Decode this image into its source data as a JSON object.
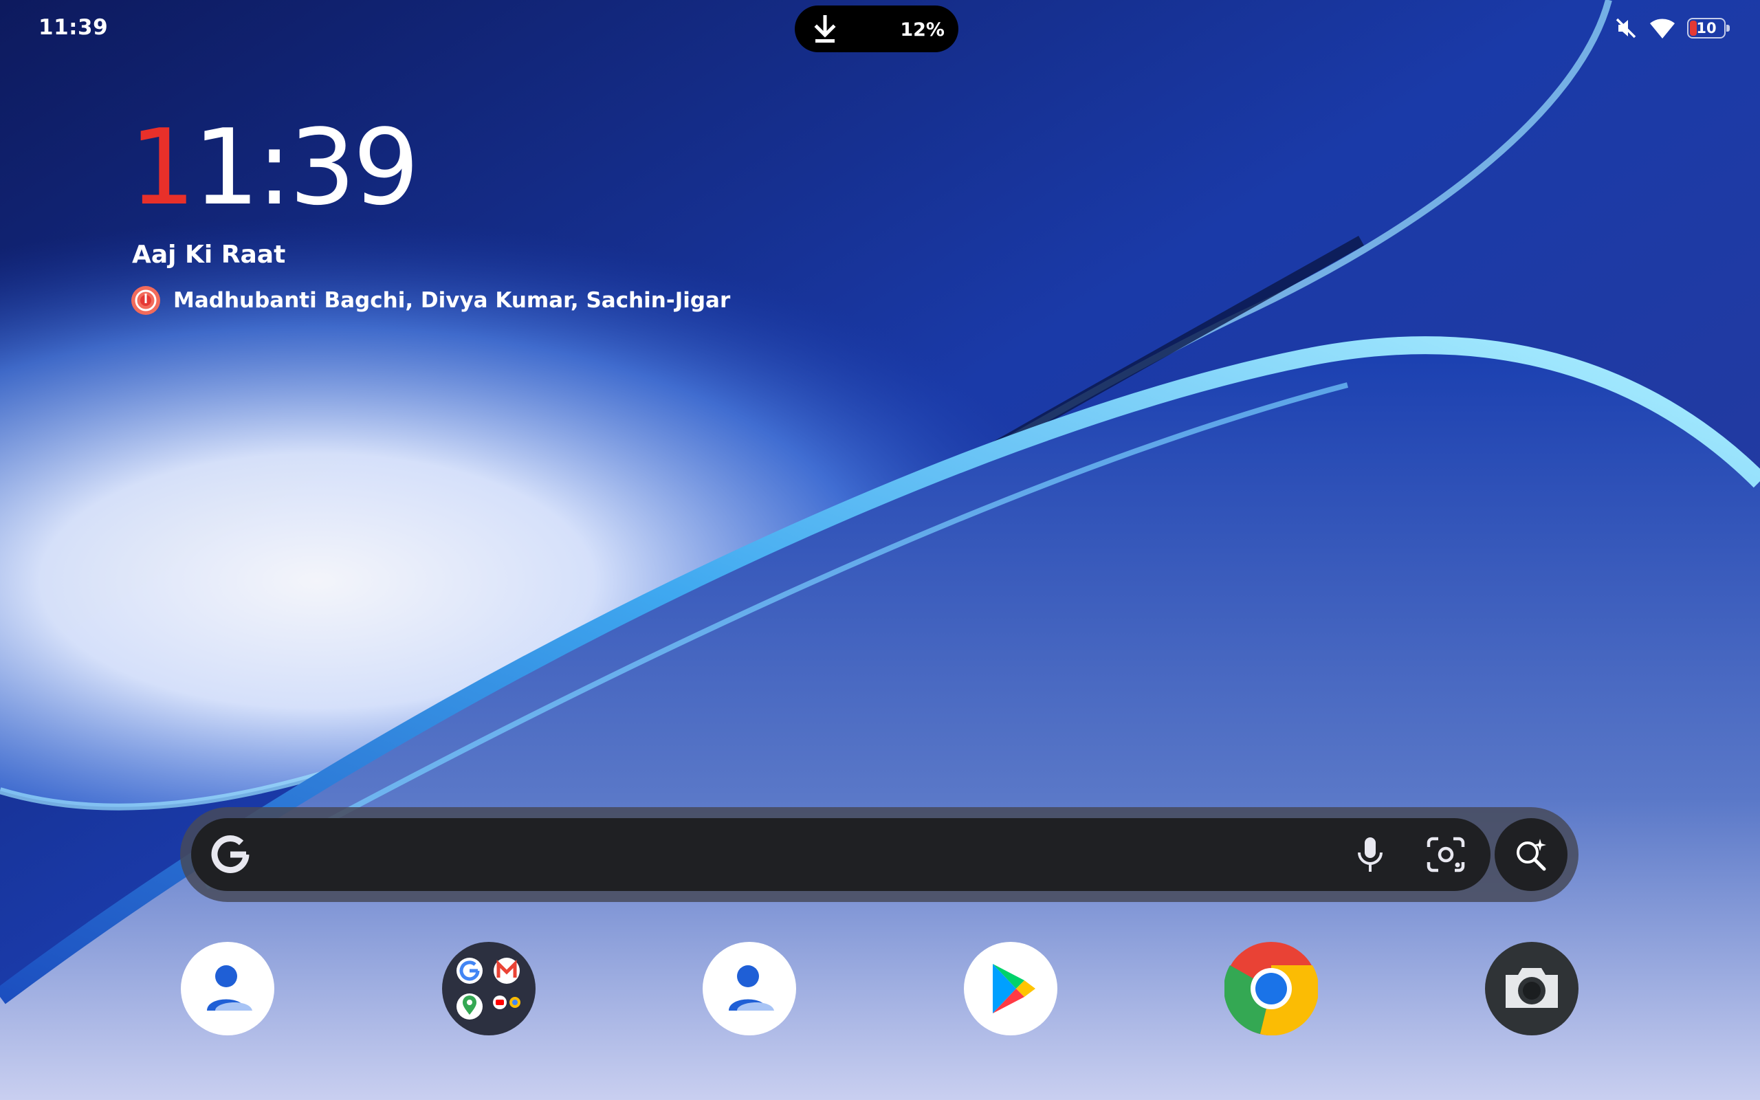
{
  "status_bar": {
    "time": "11:39",
    "download_percent": "12%",
    "battery_level": "10",
    "icons": [
      "download-icon",
      "mute-icon",
      "wifi-icon",
      "battery-icon"
    ]
  },
  "clock_widget": {
    "time_first_digit": "1",
    "time_rest": "1:39",
    "accent_color": "#e8302a"
  },
  "media_widget": {
    "title": "Aaj Ki Raat",
    "artists": "Madhubanti Bagchi, Divya Kumar, Sachin-Jigar",
    "app_icon": "music-app-icon"
  },
  "search_bar": {
    "logo": "google-g-icon",
    "icons": [
      "microphone-icon",
      "google-lens-icon",
      "ai-mode-search-icon"
    ]
  },
  "dock": {
    "apps": [
      {
        "name": "contacts-app-icon"
      },
      {
        "name": "google-apps-folder-icon",
        "folder_apps": [
          "google-icon",
          "gmail-icon",
          "maps-icon",
          "youtube-icon",
          "chrome-icon"
        ]
      },
      {
        "name": "contacts-app-icon"
      },
      {
        "name": "play-store-icon"
      },
      {
        "name": "chrome-icon"
      },
      {
        "name": "camera-icon"
      }
    ]
  }
}
